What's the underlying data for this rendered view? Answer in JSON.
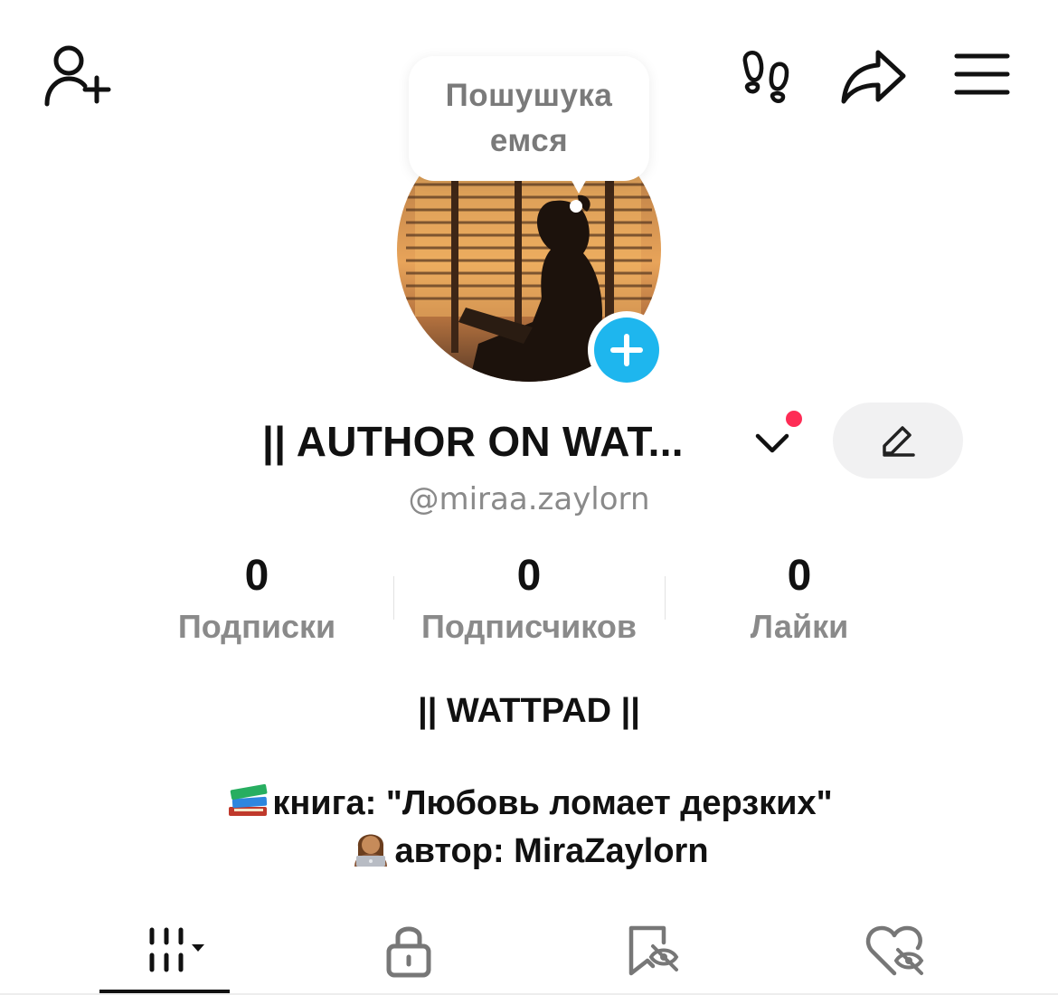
{
  "top_bar": {
    "add_friend_icon": "person-plus-icon",
    "footprints_icon": "footprints-icon",
    "share_icon": "share-arrow-icon",
    "menu_icon": "hamburger-menu-icon"
  },
  "tooltip": {
    "line1": "Пошушука",
    "line2": "емся"
  },
  "profile": {
    "display_name": "|| AUTHOR ON WAT...",
    "username": "@miraa.zaylorn",
    "has_notification": true,
    "accent_color": "#1eb6ee",
    "notification_color": "#fe2c55"
  },
  "stats": [
    {
      "value": "0",
      "label": "Подписки"
    },
    {
      "value": "0",
      "label": "Подписчиков"
    },
    {
      "value": "0",
      "label": "Лайки"
    }
  ],
  "bio": {
    "title": "|| WATTPAD ||",
    "line1": "книга: \"Любовь ломает дерзких\"",
    "line2": "автор: MiraZaylorn",
    "line1_emoji": "books-emoji",
    "line2_emoji": "person-laptop-emoji"
  },
  "tabs": [
    {
      "name": "videos-grid",
      "icon": "grid-icon",
      "active": true
    },
    {
      "name": "private",
      "icon": "lock-icon",
      "active": false
    },
    {
      "name": "saved",
      "icon": "bookmark-hidden-icon",
      "active": false
    },
    {
      "name": "liked",
      "icon": "heart-hidden-icon",
      "active": false
    }
  ]
}
